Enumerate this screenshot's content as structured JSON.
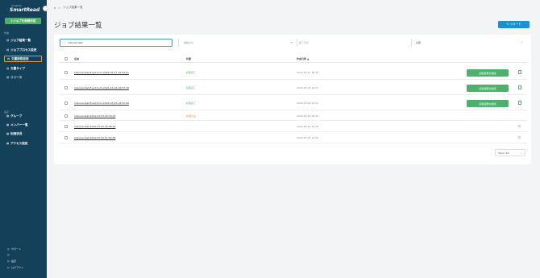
{
  "sidebar": {
    "logo_small": "cinnamon",
    "logo": "SmartRead",
    "new_job": "＋ジョブを新規作成",
    "section_main": "作業",
    "items": [
      {
        "icon": "▤",
        "label": "ジョブ結果一覧"
      },
      {
        "icon": "▤",
        "label": "ジョブプロセス設定"
      },
      {
        "icon": "▤",
        "label": "文書読取設定"
      },
      {
        "icon": "▤",
        "label": "文書タイプ"
      },
      {
        "icon": "▤",
        "label": "リリース"
      }
    ],
    "section_settings": "設定",
    "settings_items": [
      {
        "icon": "▦",
        "label": "グループ"
      },
      {
        "icon": "▦",
        "label": "メンバー一覧"
      },
      {
        "icon": "▦",
        "label": "利用状況"
      },
      {
        "icon": "▦",
        "label": "アクセス設定"
      }
    ],
    "footer": [
      {
        "icon": "◎",
        "label": "サポート"
      },
      {
        "icon": "◎",
        "label": ""
      },
      {
        "icon": "◎",
        "label": "設定"
      },
      {
        "icon": "◎",
        "label": "ログアウト"
      }
    ]
  },
  "breadcrumb": {
    "home_icon": "⌂",
    "sep": ">",
    "current": "ジョブ結果一覧"
  },
  "page_title": "ジョブ結果一覧",
  "reload_label": "↻ リロード",
  "filters": {
    "search_value": "internal test",
    "date_from": "開始日付",
    "date_to": "終了日付",
    "status": "全部"
  },
  "table": {
    "headers": {
      "name": "名前",
      "status": "状態",
      "created": "作成日時 ▲"
    },
    "rows": [
      {
        "name": "internal-test-fixed-form-2024-03-27-18:34:51",
        "status": "読取完了",
        "status_color": "#4fb06b",
        "time": "2024-03-27 18:34",
        "button": "読取結果を確認",
        "action": "doc"
      },
      {
        "name": "internal-test-fixed-form-2024-03-26-16:57:16",
        "status": "読取完了",
        "status_color": "#4fb06b",
        "time": "2024-03-26 16:57",
        "button": "読取結果を確認",
        "action": "doc"
      },
      {
        "name": "internal-test-fixed-form-2024-03-26-16:52:26",
        "status": "読取完了",
        "status_color": "#4fb06b",
        "time": "2024-03-26 16:52",
        "button": "読取結果を確認",
        "action": "doc"
      },
      {
        "name": "internal-test-2024-03-25-16:39:43",
        "status": "処理済み",
        "status_color": "#e8962f",
        "time": "2024-03-25 16:43",
        "button": "",
        "action": "none"
      },
      {
        "name": "internal-test-2024-03-25-16:08:30",
        "status": "",
        "status_color": "#888888",
        "time": "2024-03-25 16:08",
        "button": "",
        "action": "spin"
      },
      {
        "name": "internal-test-2024-03-25-11:54:46",
        "status": "",
        "status_color": "#888888",
        "time": "2024-03-25 11:54",
        "button": "",
        "action": "spin"
      }
    ]
  },
  "pagination": {
    "show": "Show (10)"
  }
}
